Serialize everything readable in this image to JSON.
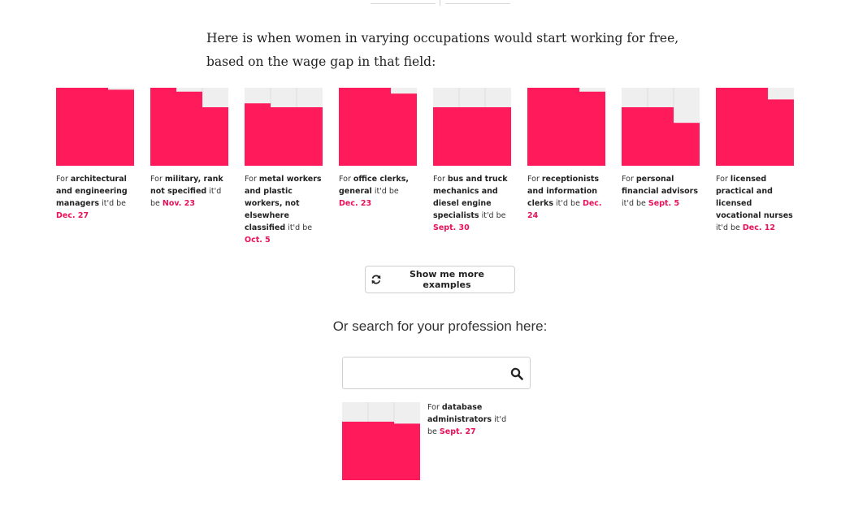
{
  "intro": "Here is when women in varying occupations would start working for free, based on the wage gap in that field:",
  "cards": [
    {
      "pre": "For ",
      "occupation": "architectural and engineering managers",
      "mid": " it'd be ",
      "date": "Dec. 27",
      "months_covered": 11.9,
      "fill": "#ff1a5b"
    },
    {
      "pre": "For ",
      "occupation": "military, rank not specified",
      "mid": " it'd be ",
      "date": "Nov. 23",
      "months_covered": 10.8
    },
    {
      "pre": "For ",
      "occupation": "metal workers and plastic workers, not elsewhere classified",
      "mid": " it'd be ",
      "date": "Oct. 5",
      "months_covered": 9.2
    },
    {
      "pre": "For ",
      "occupation": "office clerks, general",
      "mid": " it'd be ",
      "date": "Dec. 23",
      "months_covered": 11.7
    },
    {
      "pre": "For ",
      "occupation": "bus and truck mechanics and diesel engine specialists",
      "mid": " it'd be ",
      "date": "Sept. 30",
      "months_covered": 9.0
    },
    {
      "pre": "For ",
      "occupation": "receptionists and information clerks",
      "mid": " it'd be ",
      "date": "Dec. 24",
      "months_covered": 11.8
    },
    {
      "pre": "For ",
      "occupation": "personal financial advisors",
      "mid": " it'd be ",
      "date": "Sept. 5",
      "months_covered": 8.2
    },
    {
      "pre": "For ",
      "occupation": "licensed practical and licensed vocational nurses",
      "mid": " it'd be ",
      "date": "Dec. 12",
      "months_covered": 11.4
    }
  ],
  "more_button": {
    "label": "Show me more examples",
    "icon": "refresh-icon"
  },
  "search": {
    "title": "Or search for your profession here:",
    "value": "",
    "placeholder": "",
    "icon": "search-icon"
  },
  "result": {
    "pre": "For ",
    "occupation": "database administrators",
    "mid": " it'd be ",
    "date": "Sept. 27",
    "months_covered": 8.9
  },
  "colors": {
    "accent": "#ff1a5b",
    "date_text": "#e8115b",
    "tile_bg": "#efefef",
    "grid_line": "#dedede"
  }
}
